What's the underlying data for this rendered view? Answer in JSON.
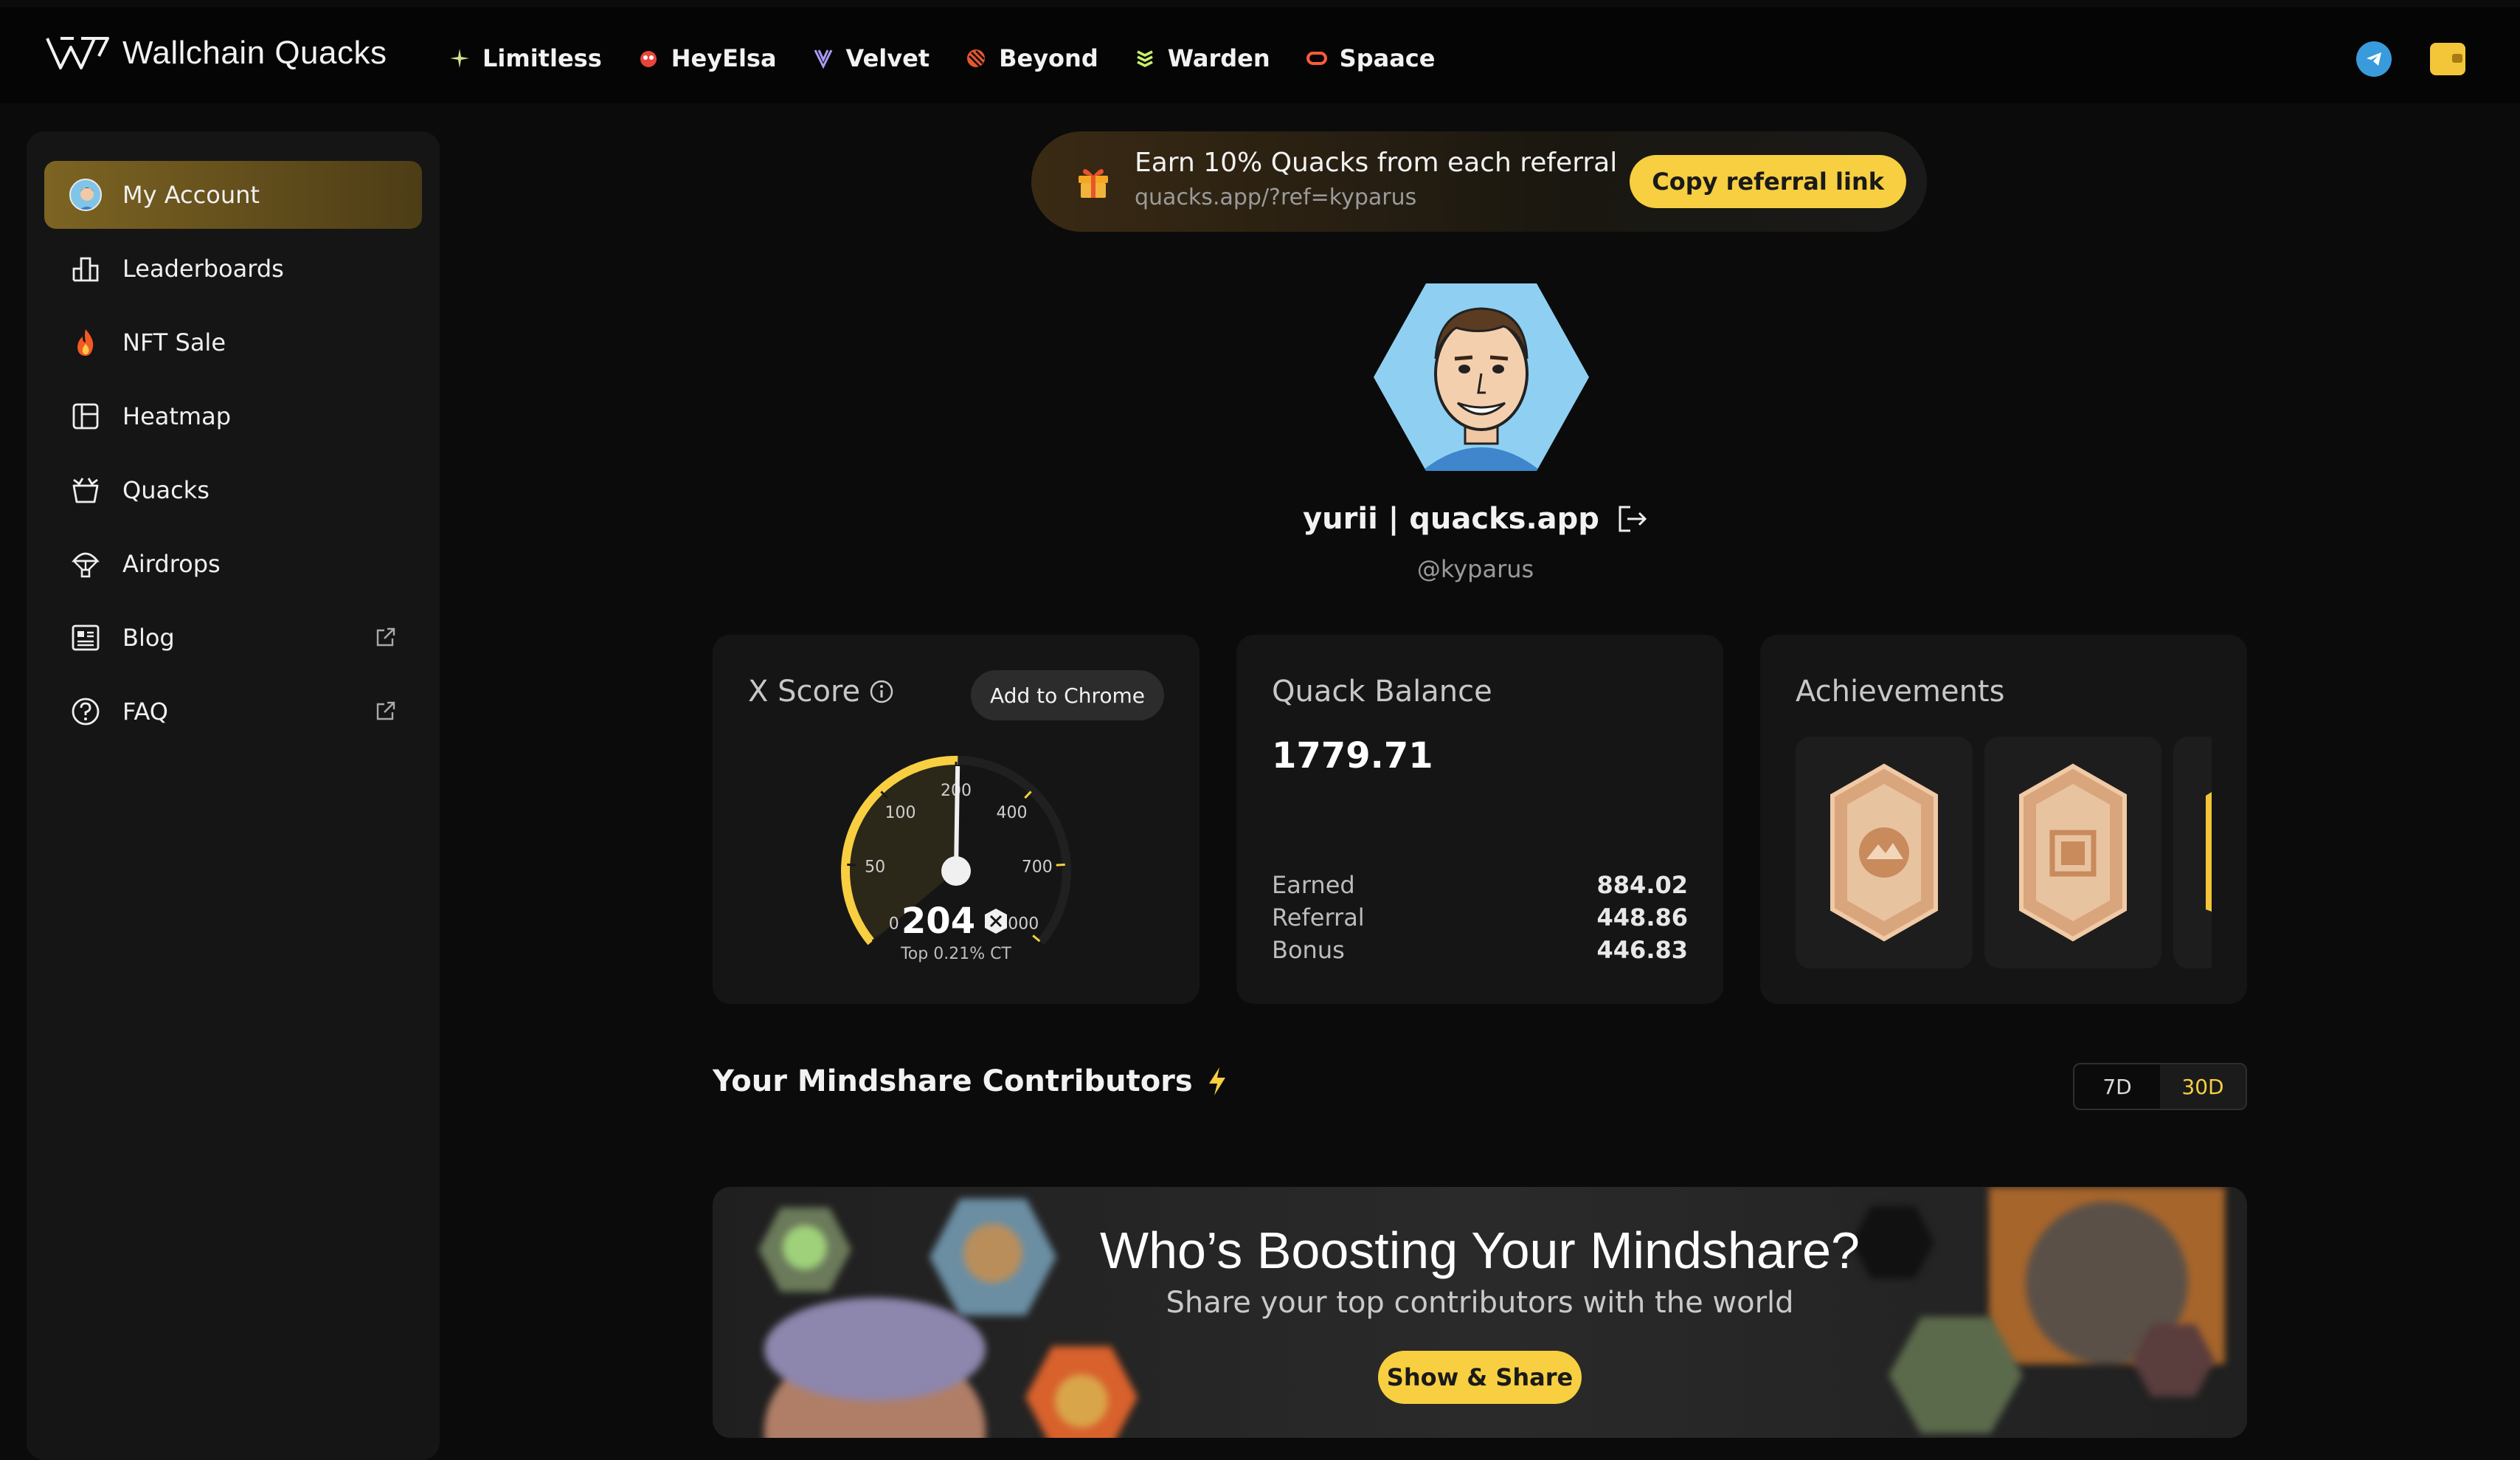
{
  "app": {
    "title": "Wallchain Quacks"
  },
  "partners": [
    {
      "label": "Limitless",
      "icon": "sparkle-icon"
    },
    {
      "label": "HeyElsa",
      "icon": "elsa-icon"
    },
    {
      "label": "Velvet",
      "icon": "velvet-icon"
    },
    {
      "label": "Beyond",
      "icon": "beyond-icon"
    },
    {
      "label": "Warden",
      "icon": "warden-icon"
    },
    {
      "label": "Spaace",
      "icon": "spaace-icon"
    }
  ],
  "sidebar": {
    "items": [
      {
        "label": "My Account",
        "icon": "avatar-icon",
        "active": true
      },
      {
        "label": "Leaderboards",
        "icon": "bar-chart-icon"
      },
      {
        "label": "NFT Sale",
        "icon": "fire-icon"
      },
      {
        "label": "Heatmap",
        "icon": "grid-icon"
      },
      {
        "label": "Quacks",
        "icon": "basket-icon"
      },
      {
        "label": "Airdrops",
        "icon": "parachute-icon"
      },
      {
        "label": "Blog",
        "icon": "news-icon",
        "external": true
      },
      {
        "label": "FAQ",
        "icon": "question-icon",
        "external": true
      }
    ]
  },
  "referral": {
    "title": "Earn 10% Quacks from each referral",
    "link": "quacks.app/?ref=kyparus",
    "button": "Copy referral link"
  },
  "profile": {
    "name": "yurii | quacks.app",
    "handle": "@kyparus"
  },
  "xscore": {
    "title": "X Score",
    "button": "Add to Chrome",
    "score": "204",
    "score_value": 204,
    "subtitle": "Top 0.21% CT",
    "ticks": [
      "0",
      "50",
      "100",
      "200",
      "400",
      "700",
      "1000"
    ]
  },
  "balance": {
    "title": "Quack Balance",
    "value": "1779.71",
    "rows": [
      {
        "label": "Earned",
        "value": "884.02"
      },
      {
        "label": "Referral",
        "value": "448.86"
      },
      {
        "label": "Bonus",
        "value": "446.83"
      }
    ]
  },
  "achievements": {
    "title": "Achievements"
  },
  "mindshare": {
    "title": "Your Mindshare Contributors",
    "ranges": [
      "7D",
      "30D"
    ],
    "selected": "30D"
  },
  "boost": {
    "title": "Who’s Boosting Your Mindshare?",
    "subtitle": "Share your top contributors with the world",
    "button": "Show & Share"
  },
  "colors": {
    "accent": "#f7cf40",
    "background": "#0b0b0b",
    "card": "#151515",
    "active_nav": "#7d6423"
  }
}
